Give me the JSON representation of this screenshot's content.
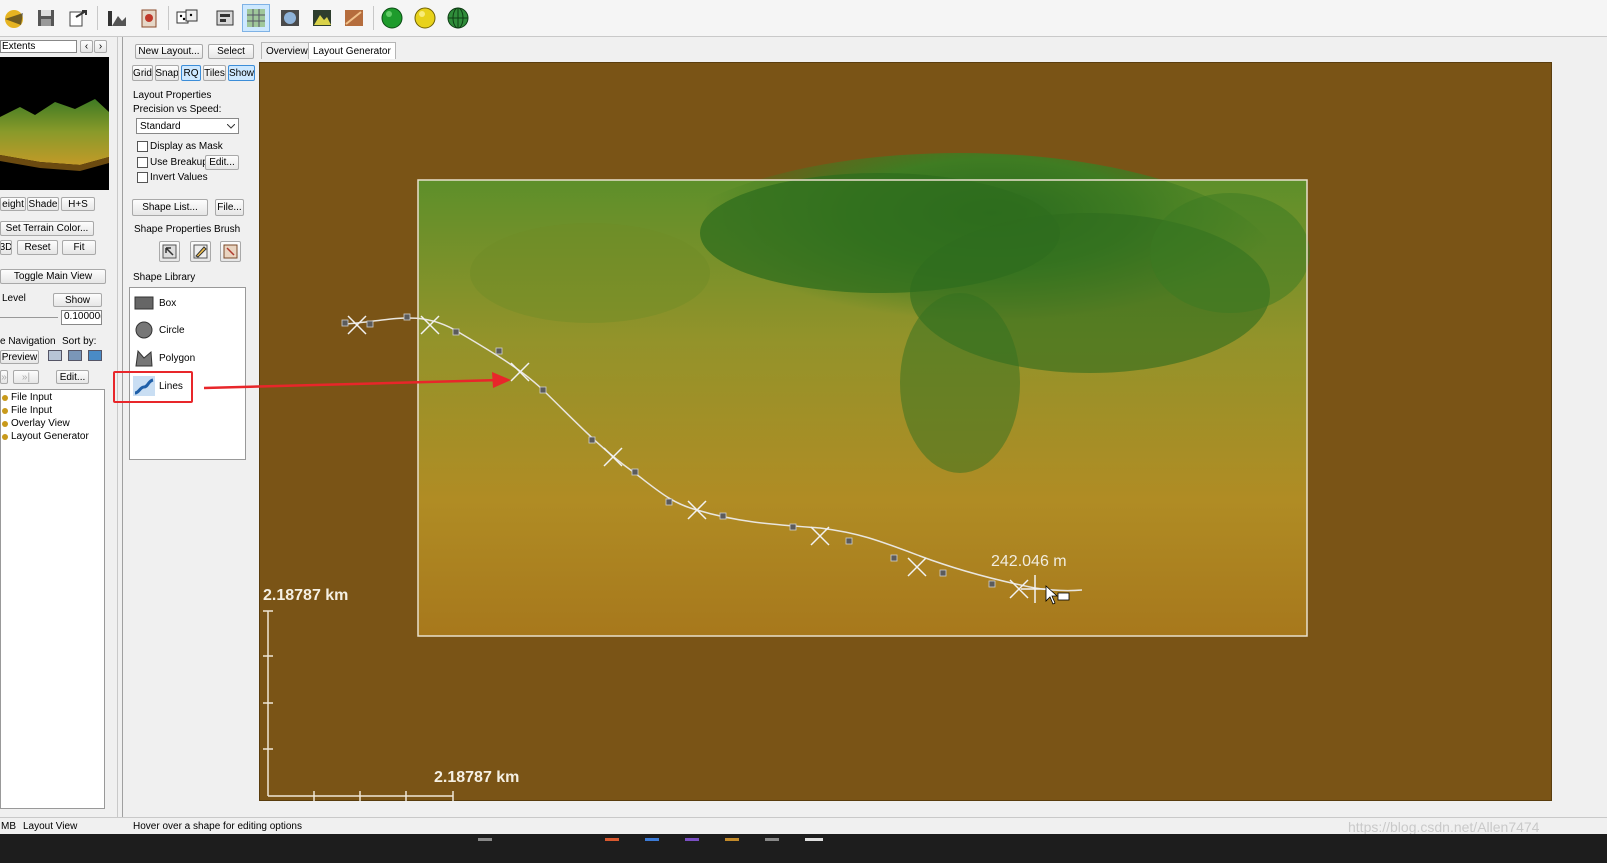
{
  "toolbar": {
    "icons": [
      "app-icon",
      "save-icon",
      "export-icon",
      "terrain-icon",
      "report-icon",
      "dice-icon",
      "layer-icon",
      "grid-view-icon",
      "globe-view-icon",
      "mountain-icon",
      "texture-icon",
      "green-sphere-icon",
      "yellow-sphere-icon",
      "globe-grid-icon"
    ]
  },
  "left_panel": {
    "extents_label": "Extents",
    "prev_arrow": "‹",
    "next_arrow": "›",
    "view_buttons": [
      "eight",
      "Shade",
      "H+S"
    ],
    "set_terrain_color": "Set Terrain Color...",
    "view_3d": "3D",
    "reset": "Reset",
    "fit": "Fit",
    "toggle_main_view": "Toggle Main View",
    "level_label": "Level",
    "show_button": "Show",
    "level_value": "0.10000(",
    "navigation_label": "e Navigation",
    "sort_by_label": "Sort by:",
    "preview_button": "Preview",
    "nav_prev": "»",
    "nav_next": "»|",
    "edit_button": "Edit...",
    "tree_items": [
      "File Input",
      "File Input",
      "Overlay View",
      "Layout Generator"
    ]
  },
  "mid_panel": {
    "new_layout": "New Layout...",
    "select": "Select",
    "toggles": [
      {
        "label": "Grid",
        "active": false
      },
      {
        "label": "Snap",
        "active": false
      },
      {
        "label": "RQ",
        "active": true
      },
      {
        "label": "Tiles",
        "active": false
      },
      {
        "label": "Show",
        "active": true
      }
    ],
    "layout_properties": "Layout Properties",
    "precision_label": "Precision vs Speed:",
    "precision_value": "Standard",
    "display_as_mask": "Display as Mask",
    "use_breakup": "Use Breakup",
    "breakup_edit": "Edit...",
    "invert_values": "Invert Values",
    "shape_list": "Shape List...",
    "file": "File...",
    "shape_properties_brush": "Shape Properties Brush",
    "shape_library": "Shape Library",
    "shapes": [
      "Box",
      "Circle",
      "Polygon",
      "Lines"
    ]
  },
  "tabs": [
    {
      "label": "Overview",
      "active": false
    },
    {
      "label": "Layout Generator",
      "active": true
    }
  ],
  "viewport": {
    "distance_label": "242.046 m",
    "scale_vertical": "2.18787 km",
    "scale_horizontal": "2.18787 km"
  },
  "status": {
    "memory": "MB",
    "view_name": "Layout View",
    "hint": "Hover over a shape for editing options"
  },
  "watermark": "https://blog.csdn.net/Allen7474",
  "colors": {
    "background_brown": "#7a5416",
    "highlight_red": "#e8262a",
    "terrain_green": "#2e6b1e",
    "terrain_yellow": "#b79524"
  }
}
